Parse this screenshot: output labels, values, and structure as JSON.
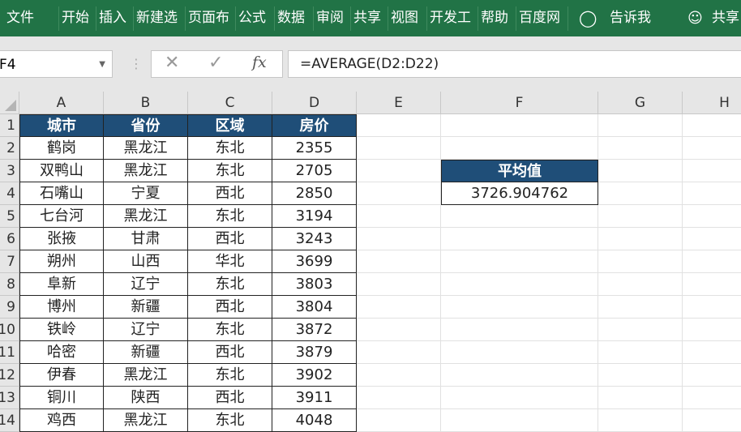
{
  "ribbon": {
    "tabs": [
      "文件",
      "开始",
      "插入",
      "新建选",
      "页面布",
      "公式",
      "数据",
      "审阅",
      "共享",
      "视图",
      "开发工",
      "帮助",
      "百度网"
    ],
    "tell_me": "告诉我",
    "share": "共享"
  },
  "formula_bar": {
    "name_box": "F4",
    "cancel": "✕",
    "enter": "✓",
    "fx": "fx",
    "formula": "=AVERAGE(D2:D22)"
  },
  "columns": [
    "A",
    "B",
    "C",
    "D",
    "E",
    "F",
    "G",
    "H"
  ],
  "rows": [
    "1",
    "2",
    "3",
    "4",
    "5",
    "6",
    "7",
    "8",
    "9",
    "10",
    "11",
    "12",
    "13",
    "14"
  ],
  "table": {
    "headers": [
      "城市",
      "省份",
      "区域",
      "房价"
    ],
    "data": [
      [
        "鹤岗",
        "黑龙江",
        "东北",
        "2355"
      ],
      [
        "双鸭山",
        "黑龙江",
        "东北",
        "2705"
      ],
      [
        "石嘴山",
        "宁夏",
        "西北",
        "2850"
      ],
      [
        "七台河",
        "黑龙江",
        "东北",
        "3194"
      ],
      [
        "张掖",
        "甘肃",
        "西北",
        "3243"
      ],
      [
        "朔州",
        "山西",
        "华北",
        "3699"
      ],
      [
        "阜新",
        "辽宁",
        "东北",
        "3803"
      ],
      [
        "博州",
        "新疆",
        "西北",
        "3804"
      ],
      [
        "铁岭",
        "辽宁",
        "东北",
        "3872"
      ],
      [
        "哈密",
        "新疆",
        "西北",
        "3879"
      ],
      [
        "伊春",
        "黑龙江",
        "东北",
        "3902"
      ],
      [
        "铜川",
        "陕西",
        "西北",
        "3911"
      ],
      [
        "鸡西",
        "黑龙江",
        "东北",
        "4048"
      ]
    ]
  },
  "summary": {
    "label": "平均值",
    "value": "3726.904762"
  },
  "colors": {
    "ribbon": "#217346",
    "header_fill": "#1f4e78"
  }
}
